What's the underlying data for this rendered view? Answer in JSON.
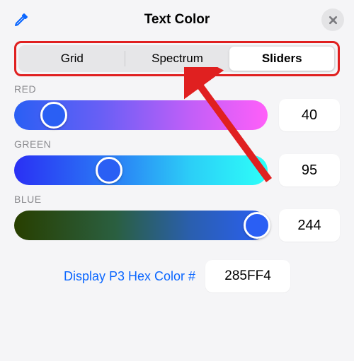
{
  "header": {
    "title": "Text Color"
  },
  "tabs": {
    "items": [
      "Grid",
      "Spectrum",
      "Sliders"
    ],
    "selected": "Sliders"
  },
  "sliders": {
    "red": {
      "label": "RED",
      "value": "40",
      "percent": 15.7
    },
    "green": {
      "label": "GREEN",
      "value": "95",
      "percent": 37.3
    },
    "blue": {
      "label": "BLUE",
      "value": "244",
      "percent": 95.7
    }
  },
  "footer": {
    "label": "Display P3 Hex Color #",
    "hex": "285FF4"
  },
  "annotation": {
    "highlight_color": "#e02020"
  }
}
